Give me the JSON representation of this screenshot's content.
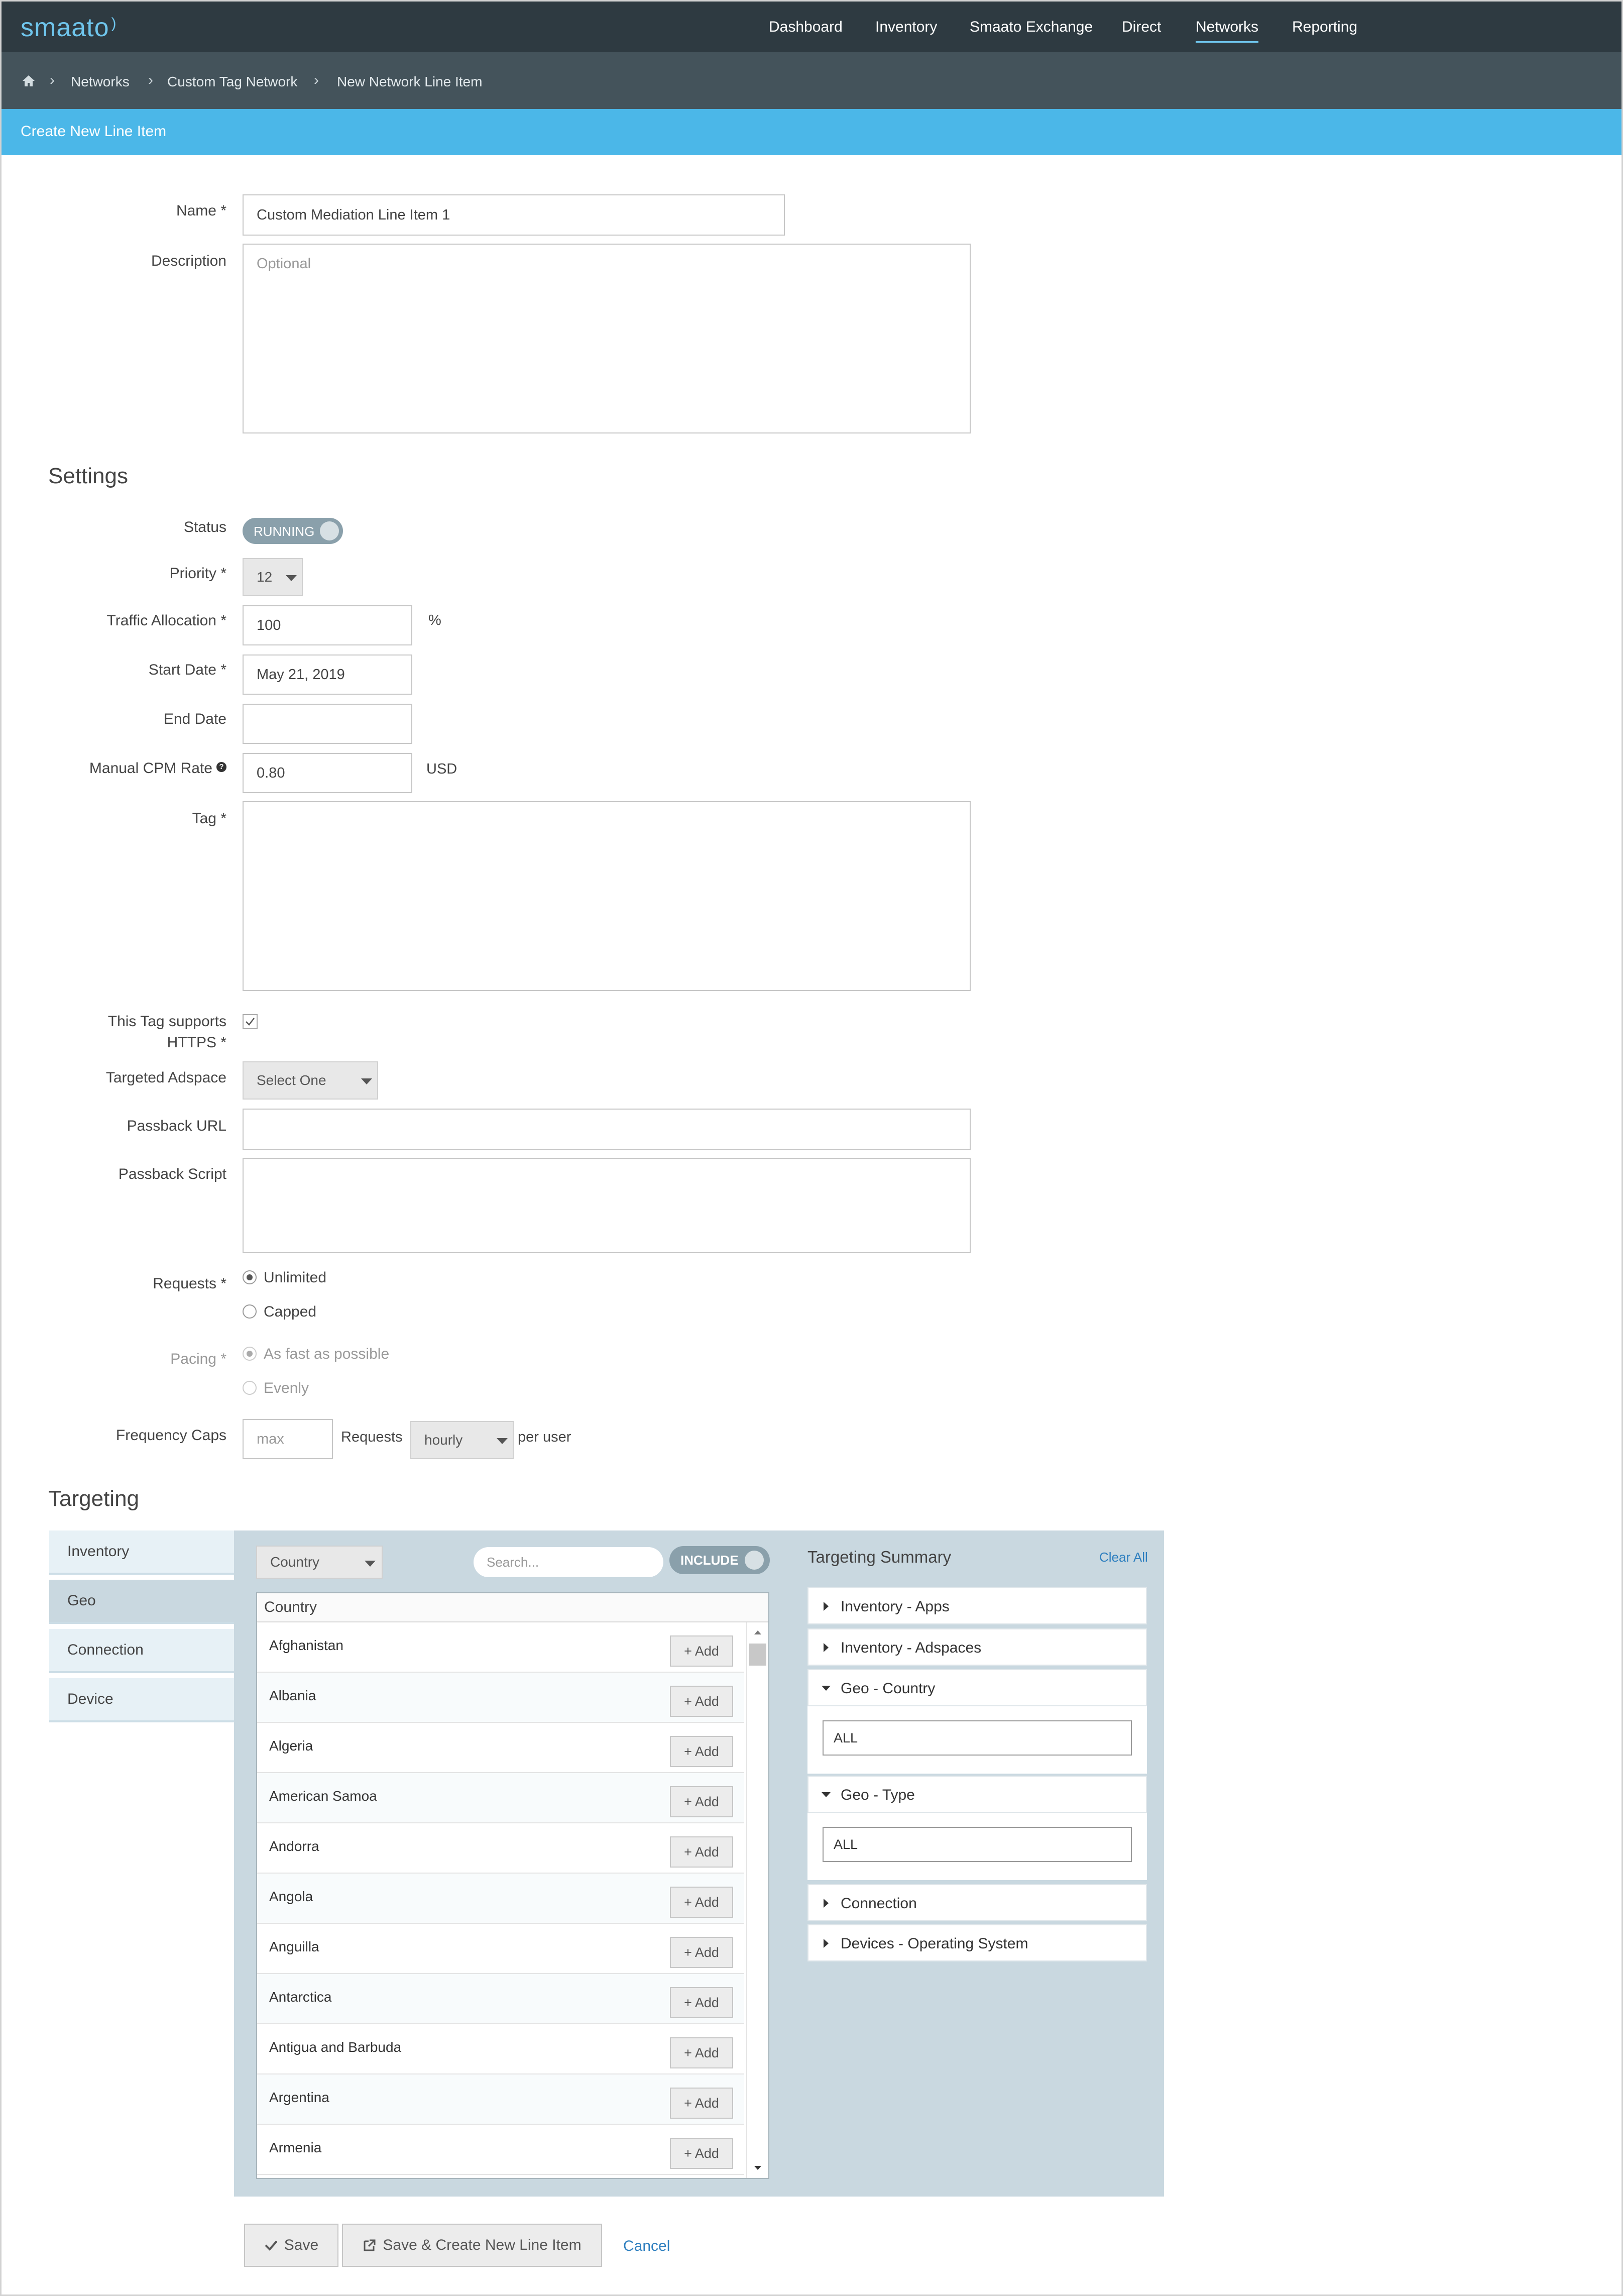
{
  "app": {
    "logo": "smaato"
  },
  "nav": {
    "items": [
      "Dashboard",
      "Inventory",
      "Smaato Exchange",
      "Direct",
      "Networks",
      "Reporting"
    ],
    "active": "Networks"
  },
  "breadcrumb": {
    "items": [
      "Networks",
      "Custom Tag Network",
      "New Network Line Item"
    ]
  },
  "page": {
    "title": "Create New Line Item"
  },
  "form": {
    "name_label": "Name *",
    "name_value": "Custom Mediation Line Item 1",
    "description_label": "Description",
    "description_placeholder": "Optional",
    "settings_heading": "Settings",
    "status_label": "Status",
    "status_value": "RUNNING",
    "priority_label": "Priority *",
    "priority_value": "12",
    "traffic_label": "Traffic Allocation *",
    "traffic_value": "100",
    "traffic_unit": "%",
    "start_label": "Start Date *",
    "start_value": "May 21, 2019",
    "end_label": "End Date",
    "end_value": "",
    "cpm_label": "Manual CPM Rate",
    "cpm_value": "0.80",
    "cpm_unit": "USD",
    "tag_label": "Tag *",
    "https_label_1": "This Tag supports",
    "https_label_2": "HTTPS *",
    "https_checked": true,
    "adspace_label": "Targeted Adspace",
    "adspace_value": "Select One",
    "passback_url_label": "Passback URL",
    "passback_script_label": "Passback Script",
    "requests_label": "Requests *",
    "requests_options": [
      "Unlimited",
      "Capped"
    ],
    "pacing_label": "Pacing *",
    "pacing_options": [
      "As fast as possible",
      "Evenly"
    ],
    "freq_label": "Frequency Caps",
    "freq_placeholder": "max",
    "freq_requests": "Requests",
    "freq_period": "hourly",
    "freq_per": "per user"
  },
  "targeting": {
    "heading": "Targeting",
    "tabs": [
      "Inventory",
      "Geo",
      "Connection",
      "Device"
    ],
    "active_tab": "Geo",
    "type_select": "Country",
    "search_placeholder": "Search...",
    "include_label": "INCLUDE",
    "list_header": "Country",
    "add_label": "+ Add",
    "countries": [
      "Afghanistan",
      "Albania",
      "Algeria",
      "American Samoa",
      "Andorra",
      "Angola",
      "Anguilla",
      "Antarctica",
      "Antigua and Barbuda",
      "Argentina",
      "Armenia"
    ],
    "summary_title": "Targeting Summary",
    "clear_all": "Clear All",
    "summary": {
      "inv_apps": "Inventory - Apps",
      "inv_adspaces": "Inventory - Adspaces",
      "geo_country": "Geo - Country",
      "geo_country_value": "ALL",
      "geo_type": "Geo - Type",
      "geo_type_value": "ALL",
      "connection": "Connection",
      "devices_os": "Devices - Operating System"
    }
  },
  "actions": {
    "save": "Save",
    "save_create": "Save & Create New Line Item",
    "cancel": "Cancel"
  },
  "colors": {
    "topnav": "#2e3a41",
    "breadcrumb": "#44535b",
    "title_bar": "#4bb7e8",
    "toggle": "#8aa0ab",
    "panel": "#c9d8e0",
    "link": "#2e7fbf"
  }
}
